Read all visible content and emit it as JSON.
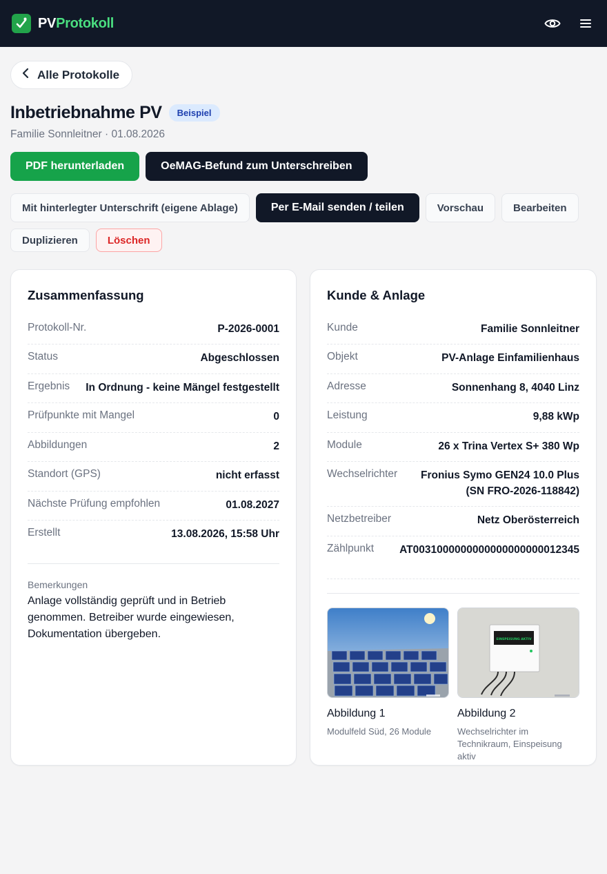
{
  "app": {
    "brand_pv": "PV",
    "brand_rest": "Protokoll"
  },
  "icons": {
    "logo": "check-clipboard-icon",
    "preview": "eye-icon",
    "menu": "hamburger-icon",
    "back": "chevron-left-icon"
  },
  "colors": {
    "accent": "#16a34a",
    "dark": "#111827",
    "danger": "#dc2626",
    "brand_green": "#4ade80"
  },
  "nav": {
    "back_label": "Alle Protokolle"
  },
  "page": {
    "title": "Inbetriebnahme PV",
    "badge": "Beispiel",
    "subtitle": "Familie Sonnleitner · 01.08.2026"
  },
  "actions": {
    "pdf": "PDF herunterladen",
    "oemag": "OeMAG-Befund zum Unterschreiben",
    "signature": "Mit hinterlegter Unterschrift (eigene Ablage)",
    "email": "Per E-Mail senden / teilen",
    "preview": "Vorschau",
    "edit": "Bearbeiten",
    "duplicate": "Duplizieren",
    "delete": "Löschen"
  },
  "summary": {
    "title": "Zusammenfassung",
    "rows": [
      {
        "label": "Protokoll-Nr.",
        "value": "P-2026-0001"
      },
      {
        "label": "Status",
        "value": "Abgeschlossen"
      },
      {
        "label": "Ergebnis",
        "value": "In Ordnung - keine Mängel festgestellt"
      },
      {
        "label": "Prüfpunkte mit Mangel",
        "value": "0"
      },
      {
        "label": "Abbildungen",
        "value": "2"
      },
      {
        "label": "Standort (GPS)",
        "value": "nicht erfasst"
      },
      {
        "label": "Nächste Prüfung empfohlen",
        "value": "01.08.2027"
      },
      {
        "label": "Erstellt",
        "value": "13.08.2026, 15:58 Uhr"
      }
    ],
    "remarks_label": "Bemerkungen",
    "remarks_text": "Anlage vollständig geprüft und in Betrieb genommen. Betreiber wurde eingewiesen, Dokumentation übergeben."
  },
  "customer": {
    "title": "Kunde & Anlage",
    "rows": [
      {
        "label": "Kunde",
        "value": "Familie Sonnleitner"
      },
      {
        "label": "Objekt",
        "value": "PV-Anlage Einfamilienhaus"
      },
      {
        "label": "Adresse",
        "value": "Sonnenhang 8, 4040 Linz"
      },
      {
        "label": "Leistung",
        "value": "9,88 kWp"
      },
      {
        "label": "Module",
        "value": "26 x Trina Vertex S+ 380 Wp"
      },
      {
        "label": "Wechselrichter",
        "value": "Fronius Symo GEN24 10.0 Plus (SN FRO-2026-118842)"
      },
      {
        "label": "Netzbetreiber",
        "value": "Netz Oberösterreich"
      },
      {
        "label": "Zählpunkt",
        "value": "AT0031000000000000000000012345"
      }
    ],
    "figures": [
      {
        "caption": "Abbildung 1",
        "description": "Modulfeld Süd, 26 Module"
      },
      {
        "caption": "Abbildung 2",
        "description": "Wechselrichter im Technikraum, Einspeisung aktiv",
        "display_text": "EINSPEISUNG AKTIV"
      }
    ]
  }
}
